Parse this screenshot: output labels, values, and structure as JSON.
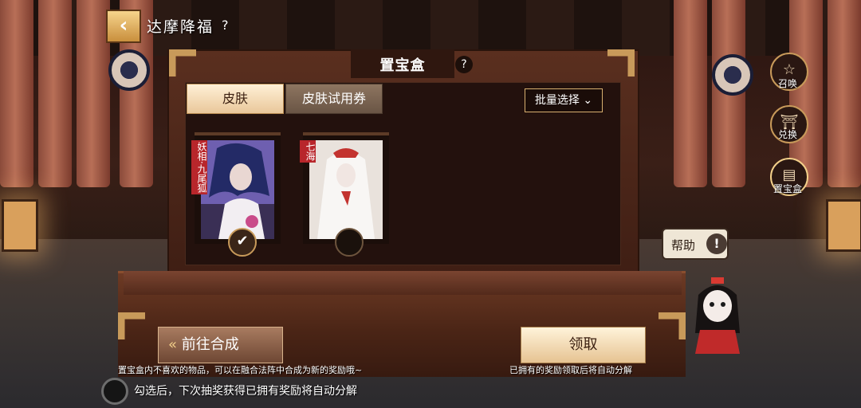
{
  "header": {
    "title": "达摩降福",
    "help": "?"
  },
  "side_menu": [
    {
      "label": "召唤",
      "icon": "pentagram-icon"
    },
    {
      "label": "兑换",
      "icon": "shrine-icon"
    },
    {
      "label": "置宝盒",
      "icon": "treasure-box-icon"
    }
  ],
  "box": {
    "title": "置宝盒",
    "help": "?",
    "tabs": [
      {
        "label": "皮肤",
        "active": true
      },
      {
        "label": "皮肤试用券",
        "active": false
      }
    ],
    "batch_select": "批量选择",
    "items": [
      {
        "name": "妖相·九尾狐",
        "checked": true
      },
      {
        "name": "七海",
        "checked": false
      }
    ],
    "goto_synthesis": "前往合成",
    "claim": "领取",
    "hint_left": "置宝盒内不喜欢的物品，可以在融合法阵中合成为新的奖励哦~",
    "hint_right": "已拥有的奖励领取后将自动分解",
    "auto_decompose": "勾选后，下次抽奖获得已拥有奖励将自动分解"
  },
  "help_bubble": {
    "label": "帮助"
  },
  "colors": {
    "accent_gold": "#c89a5a",
    "panel_brown": "#3d1d13",
    "tab_cream": "#f6e0bd"
  }
}
